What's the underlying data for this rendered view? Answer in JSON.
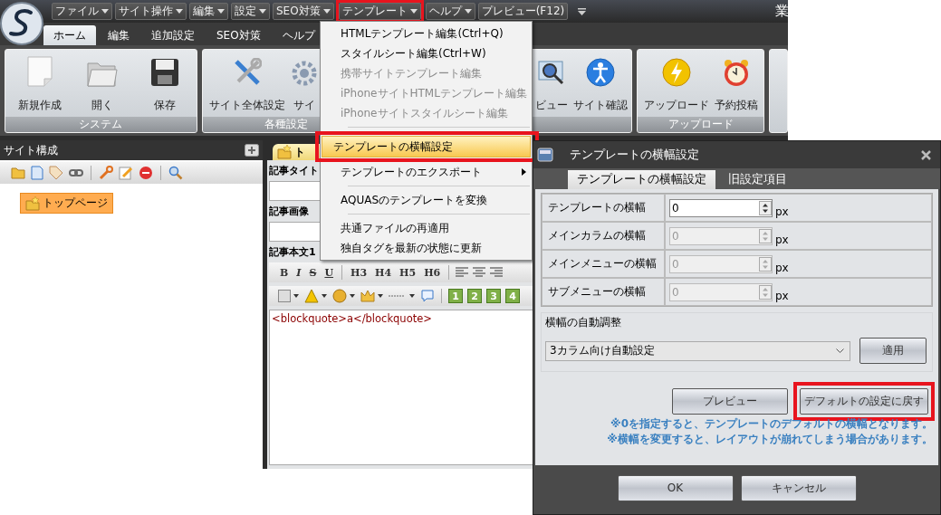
{
  "app": {
    "window_title": "業",
    "quick_menu": [
      {
        "label": "ファイル",
        "dropdown": true,
        "highlighted": false
      },
      {
        "label": "サイト操作",
        "dropdown": true,
        "highlighted": false
      },
      {
        "label": "編集",
        "dropdown": true,
        "highlighted": false
      },
      {
        "label": "設定",
        "dropdown": true,
        "highlighted": false
      },
      {
        "label": "SEO対策",
        "dropdown": true,
        "highlighted": false
      },
      {
        "label": "テンプレート",
        "dropdown": true,
        "highlighted": true
      },
      {
        "label": "ヘルプ",
        "dropdown": true,
        "highlighted": false
      },
      {
        "label": "プレビュー(F12)",
        "dropdown": false,
        "highlighted": false
      }
    ],
    "ribbon_tabs": [
      {
        "label": "ホーム",
        "selected": true
      },
      {
        "label": "編集",
        "selected": false
      },
      {
        "label": "追加設定",
        "selected": false
      },
      {
        "label": "SEO対策",
        "selected": false
      },
      {
        "label": "ヘルプ",
        "selected": false
      }
    ],
    "ribbon_groups": [
      {
        "title": "システム",
        "items": [
          {
            "label": "新規作成"
          },
          {
            "label": "開く"
          },
          {
            "label": "保存"
          }
        ]
      },
      {
        "title": "各種設定",
        "items": [
          {
            "label": "サイト全体設定"
          },
          {
            "label": "サイ"
          },
          {
            "label": "ビュー"
          },
          {
            "label": "サイト確認"
          }
        ]
      },
      {
        "title": "アップロード",
        "items": [
          {
            "label": "アップロード"
          },
          {
            "label": "予約投稿"
          }
        ]
      }
    ]
  },
  "site_panel": {
    "title": "サイト構成",
    "tree": [
      {
        "label": "トップページ",
        "selected": true
      }
    ]
  },
  "editor": {
    "tab": "ト",
    "fields": [
      {
        "label": "記事タイト"
      },
      {
        "label": "記事画像"
      }
    ],
    "body_label": "記事本文1",
    "format_buttons": [
      "B",
      "I",
      "S",
      "U",
      "H3",
      "H4",
      "H5",
      "H6"
    ],
    "numbered_buttons": [
      "1",
      "2",
      "3",
      "4"
    ],
    "content": "<blockquote>a</blockquote>"
  },
  "template_menu": [
    {
      "kind": "item",
      "label": "HTMLテンプレート編集(Ctrl+Q)",
      "disabled": false,
      "selected": false,
      "highlighted": false
    },
    {
      "kind": "item",
      "label": "スタイルシート編集(Ctrl+W)",
      "disabled": false,
      "selected": false,
      "highlighted": false
    },
    {
      "kind": "item",
      "label": "携帯サイトテンプレート編集",
      "disabled": true,
      "selected": false,
      "highlighted": false
    },
    {
      "kind": "item",
      "label": "iPhoneサイトHTMLテンプレート編集",
      "disabled": true,
      "selected": false,
      "highlighted": false
    },
    {
      "kind": "item",
      "label": "iPhoneサイトスタイルシート編集",
      "disabled": true,
      "selected": false,
      "highlighted": false
    },
    {
      "kind": "separator"
    },
    {
      "kind": "item",
      "label": "テンプレートの横幅設定",
      "disabled": false,
      "selected": true,
      "highlighted": true
    },
    {
      "kind": "submenu",
      "label": "テンプレートのエクスポート",
      "disabled": false,
      "selected": false,
      "highlighted": false
    },
    {
      "kind": "separator"
    },
    {
      "kind": "item",
      "label": "AQUASのテンプレートを変換",
      "disabled": false,
      "selected": false,
      "highlighted": false
    },
    {
      "kind": "separator"
    },
    {
      "kind": "item",
      "label": "共通ファイルの再適用",
      "disabled": false,
      "selected": false,
      "highlighted": false
    },
    {
      "kind": "item",
      "label": "独自タグを最新の状態に更新",
      "disabled": false,
      "selected": false,
      "highlighted": false
    }
  ],
  "dialog": {
    "title": "テンプレートの横幅設定",
    "tabs": [
      {
        "label": "テンプレートの横幅設定",
        "selected": true
      },
      {
        "label": "旧設定項目",
        "selected": false
      }
    ],
    "rows": [
      {
        "label": "テンプレートの横幅",
        "value": "0",
        "unit": "px",
        "disabled": false
      },
      {
        "label": "メインカラムの横幅",
        "value": "0",
        "unit": "px",
        "disabled": true
      },
      {
        "label": "メインメニューの横幅",
        "value": "0",
        "unit": "px",
        "disabled": true
      },
      {
        "label": "サブメニューの横幅",
        "value": "0",
        "unit": "px",
        "disabled": true
      }
    ],
    "auto_adjust": {
      "title": "横幅の自動調整",
      "value": "3カラム向け自動設定",
      "button": "適用"
    },
    "buttons": [
      {
        "label": "プレビュー",
        "highlighted": false
      },
      {
        "label": "デフォルトの設定に戻す",
        "highlighted": true
      }
    ],
    "notes": [
      "※0を指定すると、テンプレートのデフォルトの横幅となります。",
      "※横幅を変更すると、レイアウトが崩れてしまう場合があります。"
    ],
    "footer_buttons": [
      "OK",
      "キャンセル"
    ]
  }
}
